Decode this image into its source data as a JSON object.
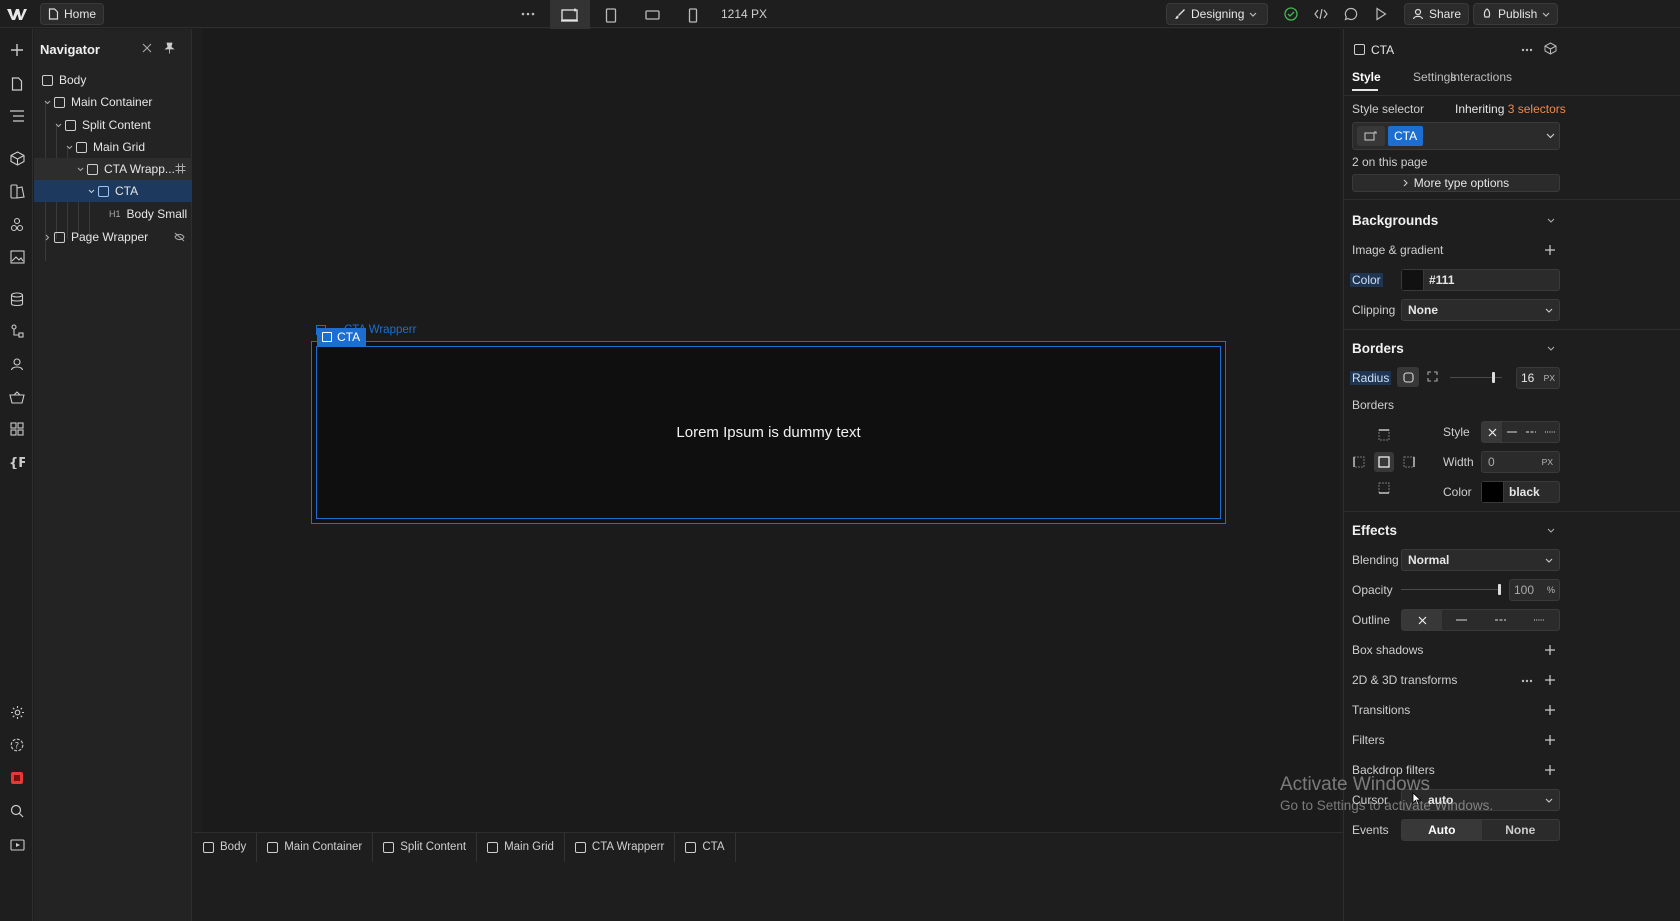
{
  "topbar": {
    "home_label": "Home",
    "width_readout": "1214 PX",
    "mode_label": "Designing",
    "share_label": "Share",
    "publish_label": "Publish"
  },
  "navigator": {
    "title": "Navigator",
    "items": [
      {
        "label": "Body"
      },
      {
        "label": "Main Container"
      },
      {
        "label": "Split Content"
      },
      {
        "label": "Main Grid"
      },
      {
        "label": "CTA Wrapp..."
      },
      {
        "label": "CTA"
      },
      {
        "label": "Body Small",
        "tag": "H1"
      },
      {
        "label": "Page Wrapper"
      }
    ]
  },
  "canvas": {
    "wrapper_tag": "CTA Wrapperr",
    "cta_tag": "CTA",
    "cta_text": "Lorem Ipsum is dummy text"
  },
  "breadcrumb": [
    "Body",
    "Main Container",
    "Split Content",
    "Main Grid",
    "CTA Wrapperr",
    "CTA"
  ],
  "panel": {
    "element_name": "CTA",
    "tabs": [
      "Style",
      "Settings",
      "Interactions"
    ],
    "style_selector_label": "Style selector",
    "inheriting_label": "Inheriting",
    "inheriting_count": "3 selectors",
    "selector_chip": "CTA",
    "on_page": "2 on this page",
    "more_type": "More type options",
    "backgrounds": {
      "title": "Backgrounds",
      "image_gradient": "Image & gradient",
      "color_label": "Color",
      "color_value": "#111",
      "clipping_label": "Clipping",
      "clipping_value": "None"
    },
    "borders": {
      "title": "Borders",
      "radius_label": "Radius",
      "radius_value": "16",
      "radius_unit": "PX",
      "radius_fraction": 0.85,
      "borders_label": "Borders",
      "style_label": "Style",
      "width_label": "Width",
      "width_value": "0",
      "width_unit": "PX",
      "color_label": "Color",
      "color_value": "black"
    },
    "effects": {
      "title": "Effects",
      "blending_label": "Blending",
      "blending_value": "Normal",
      "opacity_label": "Opacity",
      "opacity_value": "100",
      "opacity_unit": "%",
      "opacity_fraction": 1.0,
      "outline_label": "Outline",
      "box_shadows": "Box shadows",
      "transforms": "2D & 3D transforms",
      "transitions": "Transitions",
      "filters": "Filters",
      "backdrop_filters": "Backdrop filters",
      "cursor_label": "Cursor",
      "cursor_value": "auto",
      "events_label": "Events",
      "events_auto": "Auto",
      "events_none": "None"
    }
  },
  "watermark": {
    "line1": "Activate Windows",
    "line2": "Go to Settings to activate Windows."
  },
  "colors": {
    "accent": "#1c6fd1",
    "inheriting_accent": "#f08a4b",
    "cta_bg": "#111111"
  }
}
